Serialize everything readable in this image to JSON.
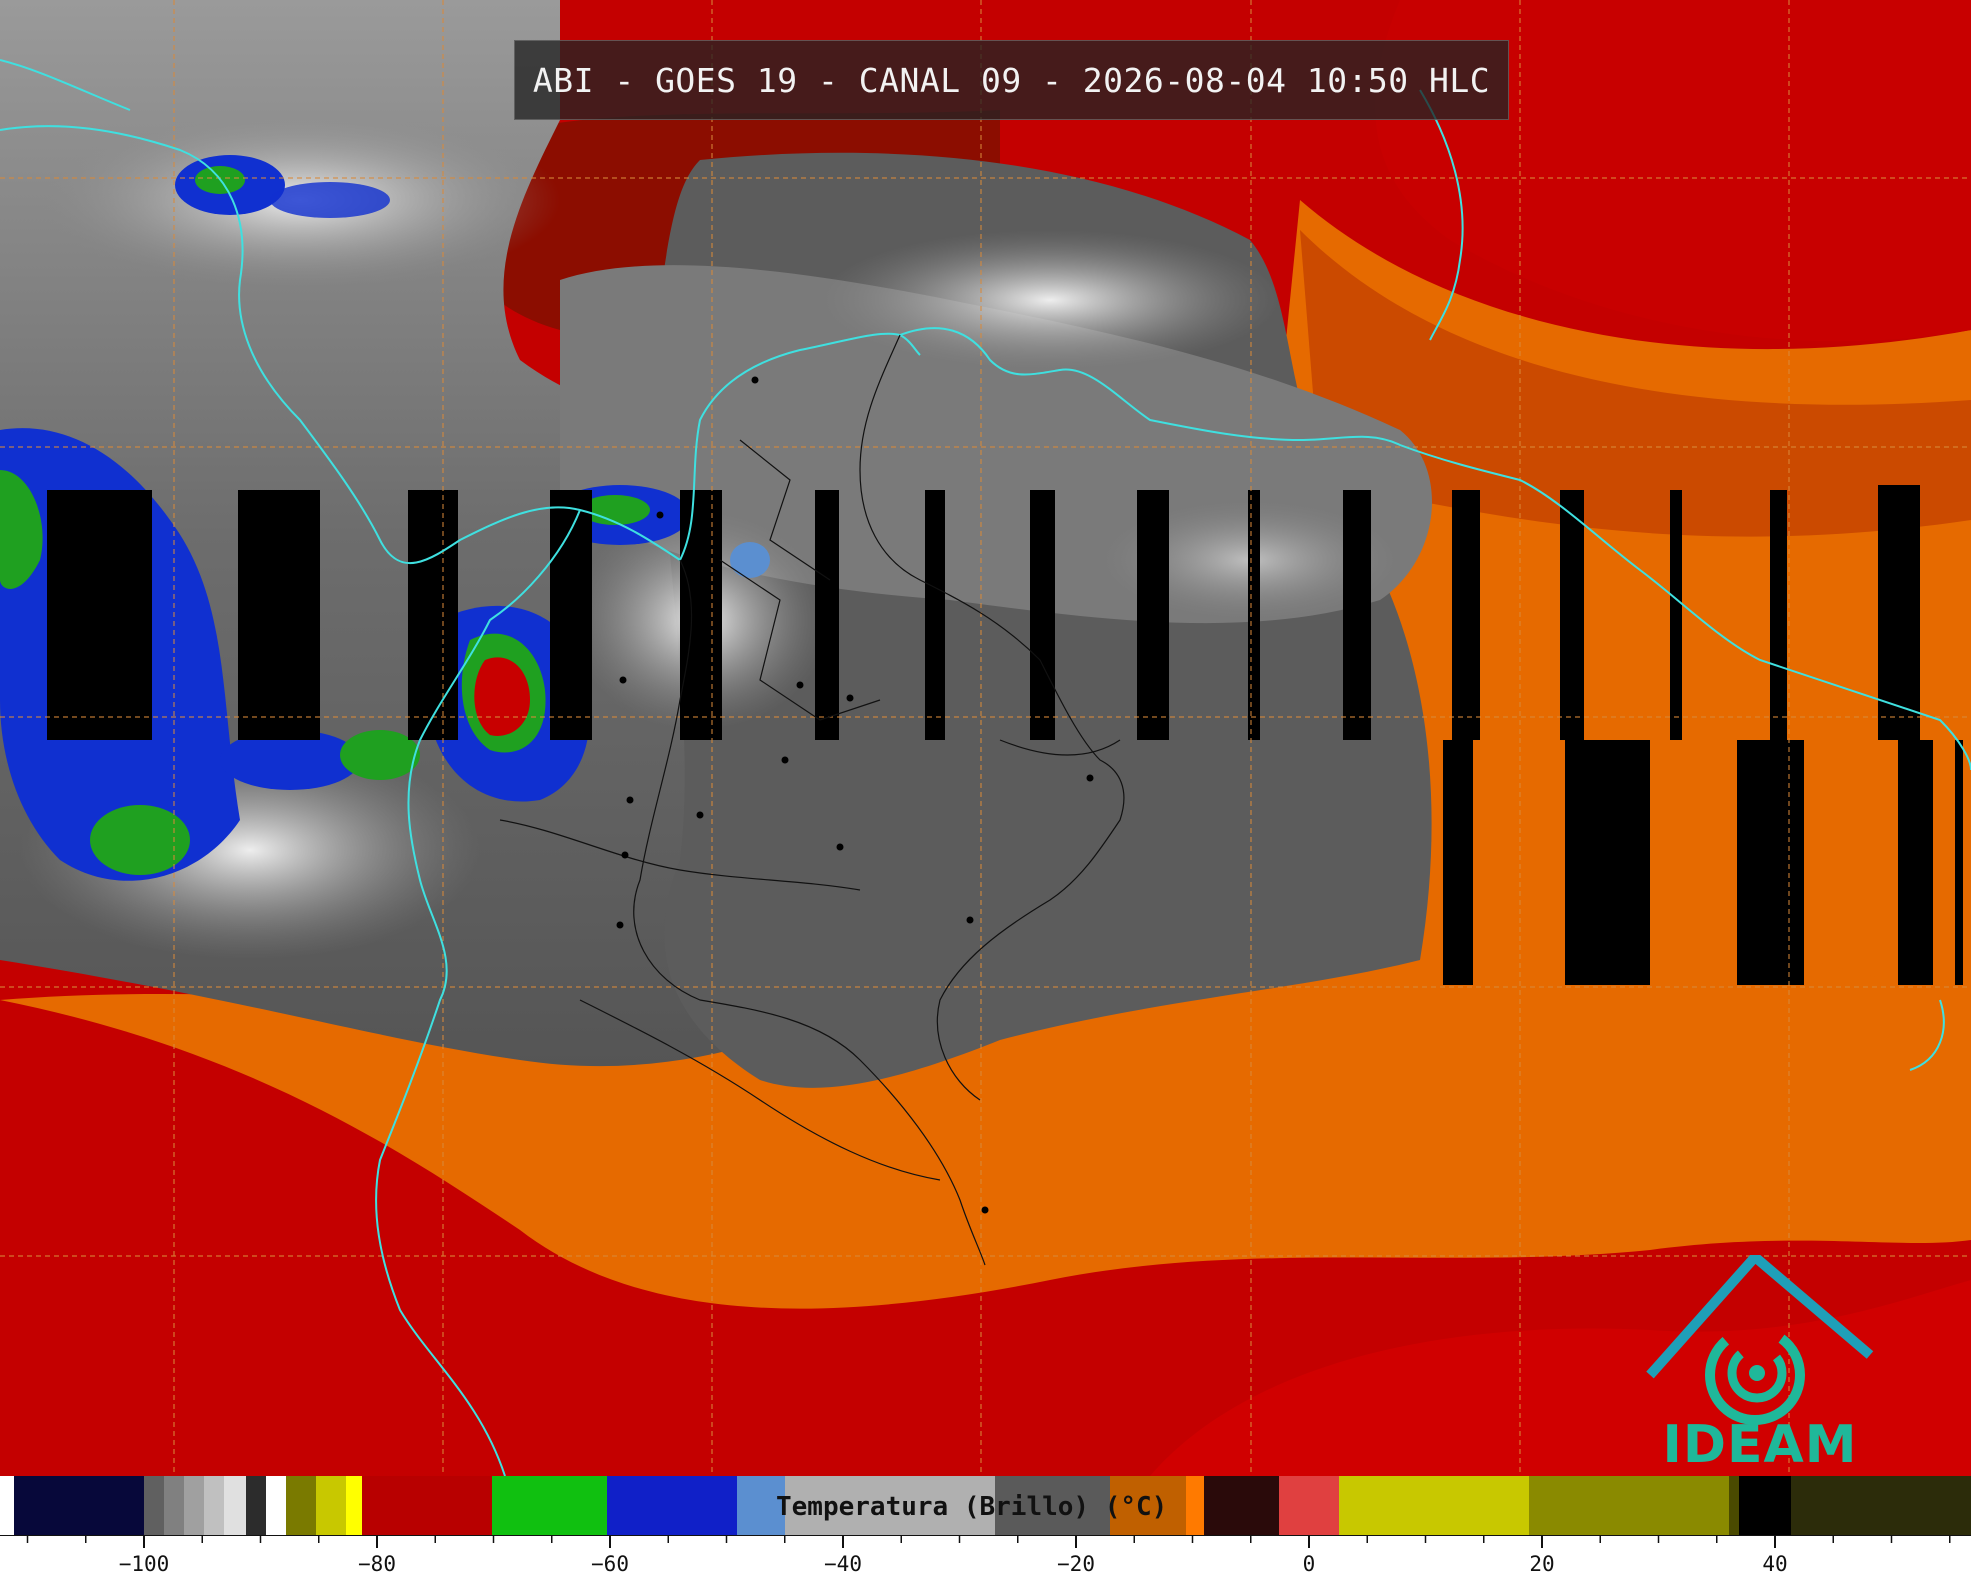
{
  "header": {
    "title": "ABI - GOES 19 - CANAL 09 - 2026-08-04 10:50 HLC"
  },
  "logo": {
    "text": "IDEAM",
    "color": "#1fb89a"
  },
  "colorbar": {
    "label": "Temperatura (Brillo) (°C)",
    "range": [
      -112,
      55
    ],
    "ticks": [
      -100,
      -80,
      -60,
      -40,
      -20,
      0,
      20,
      40
    ],
    "tick_labels": [
      "−100",
      "−80",
      "−60",
      "−40",
      "−20",
      "0",
      "20",
      "40"
    ]
  },
  "colors": {
    "coastline": "#3fe0e0",
    "graticule": "#d98a3a",
    "cloud_gray": "#8a8a8a",
    "warm_red": "#c00000",
    "warm_orange": "#e26d00",
    "cold_blue": "#1030d0",
    "cold_green": "#1fa020"
  }
}
